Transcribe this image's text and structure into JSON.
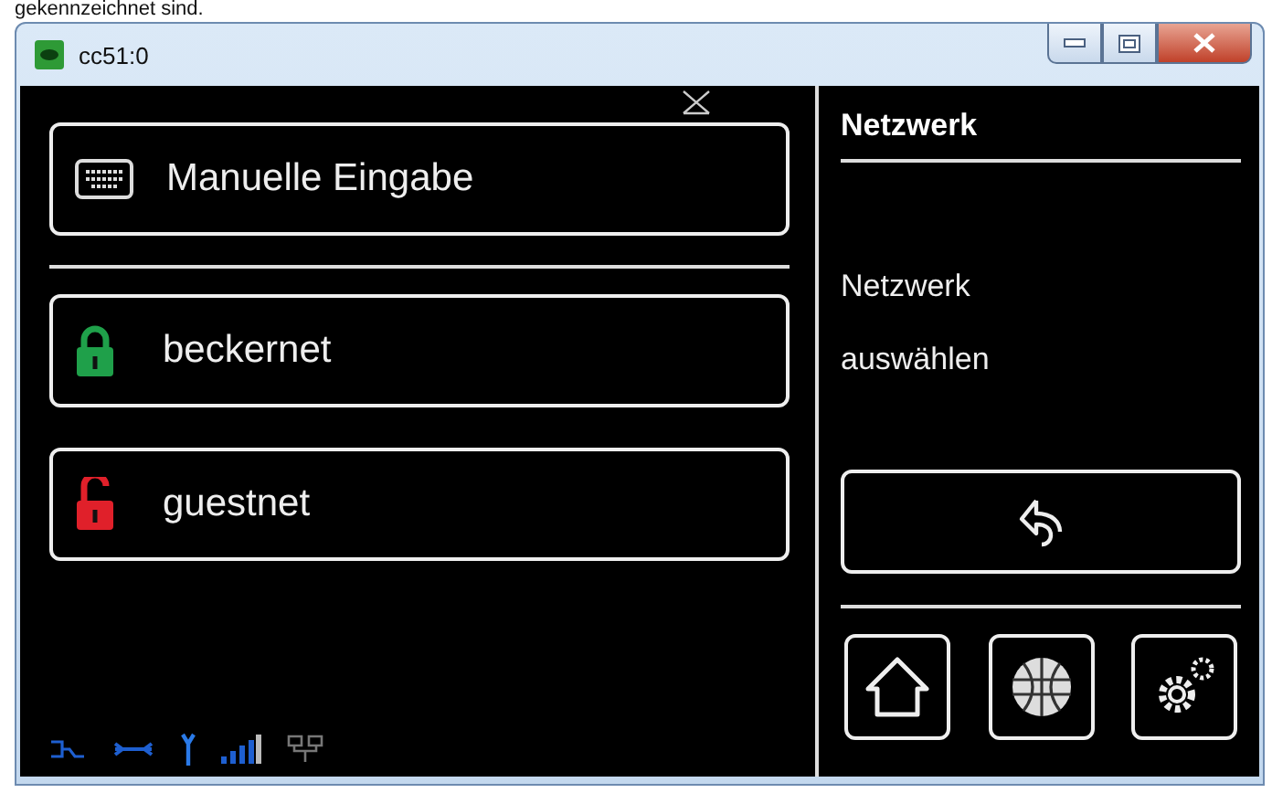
{
  "page_caption": "gekennzeichnet sind.",
  "window": {
    "title": "cc51:0"
  },
  "manual_entry": {
    "label": "Manuelle Eingabe"
  },
  "networks": [
    {
      "name": "beckernet",
      "locked": true,
      "color": "#1fa04a"
    },
    {
      "name": "guestnet",
      "locked": false,
      "color": "#e0202a"
    }
  ],
  "side_panel": {
    "heading": "Netzwerk",
    "instruction_lines": [
      "Netzwerk",
      "auswählen"
    ]
  }
}
